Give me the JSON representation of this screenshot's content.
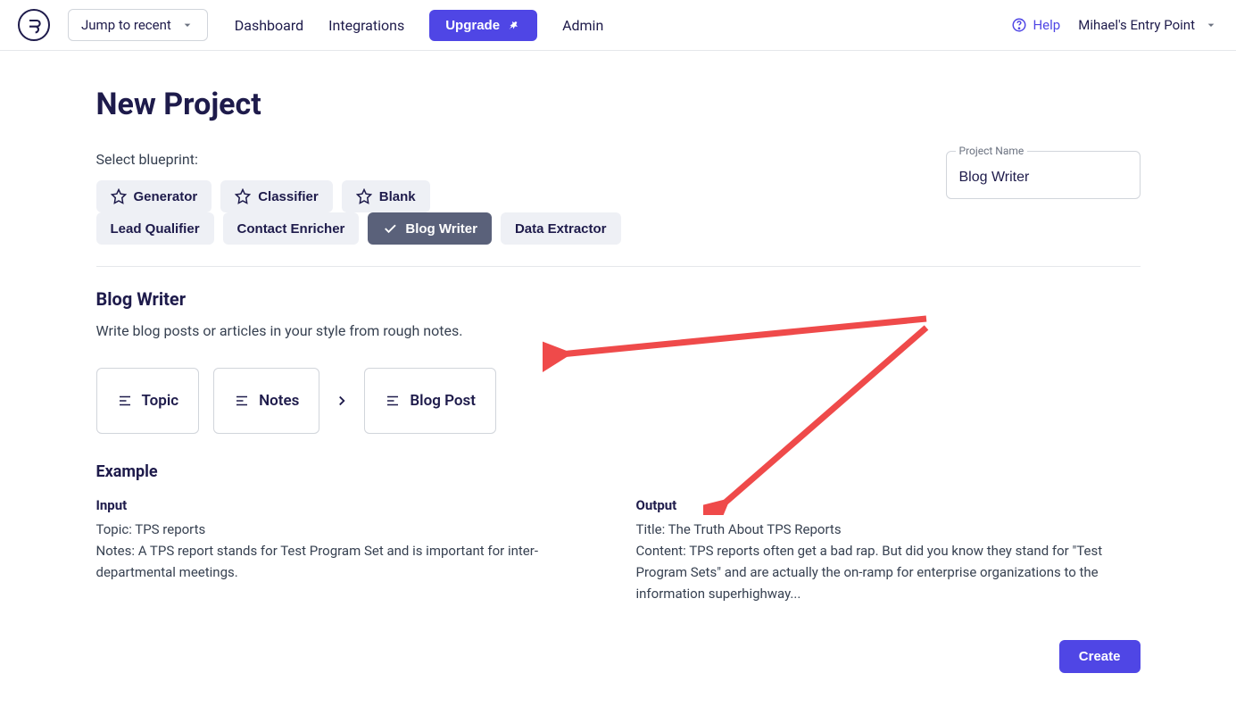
{
  "header": {
    "jump_label": "Jump to recent",
    "nav": {
      "dashboard": "Dashboard",
      "integrations": "Integrations",
      "admin": "Admin"
    },
    "upgrade": "Upgrade",
    "help": "Help",
    "workspace": "Mihael's Entry Point"
  },
  "page": {
    "title": "New Project",
    "select_blueprint": "Select blueprint:",
    "project_name_label": "Project Name",
    "project_name_value": "Blog Writer"
  },
  "blueprints_row1": [
    {
      "label": "Generator",
      "starred": true
    },
    {
      "label": "Classifier",
      "starred": true
    },
    {
      "label": "Blank",
      "starred": true
    }
  ],
  "blueprints_row2": [
    {
      "label": "Lead Qualifier"
    },
    {
      "label": "Contact Enricher"
    },
    {
      "label": "Blog Writer",
      "selected": true
    },
    {
      "label": "Data Extractor"
    }
  ],
  "detail": {
    "title": "Blog Writer",
    "desc": "Write blog posts or articles in your style from rough notes.",
    "inputs": [
      {
        "label": "Topic"
      },
      {
        "label": "Notes"
      }
    ],
    "output": {
      "label": "Blog Post"
    }
  },
  "example": {
    "heading": "Example",
    "input_header": "Input",
    "input_topic": "Topic: TPS reports",
    "input_notes": "Notes: A TPS report stands for Test Program Set and is important for inter-departmental meetings.",
    "output_header": "Output",
    "output_title": "Title: The Truth About TPS Reports",
    "output_content": "Content: TPS reports often get a bad rap. But did you know they stand for \"Test Program Sets\" and are actually the on-ramp for enterprise organizations to the information superhighway..."
  },
  "create": "Create"
}
